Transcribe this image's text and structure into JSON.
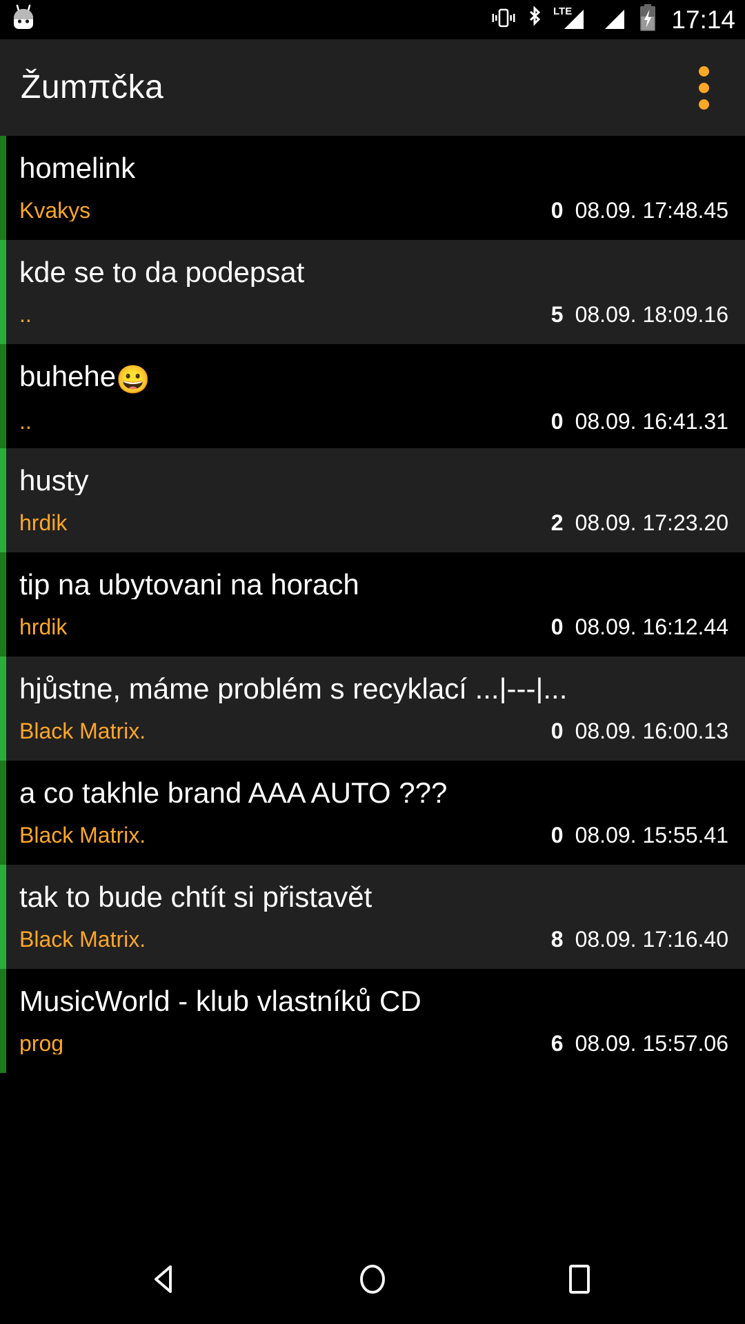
{
  "status_bar": {
    "notification_icon": "android-marshmallow-icon",
    "icons": [
      "vibrate-icon",
      "bluetooth-icon",
      "lte-signal-icon",
      "signal-icon",
      "battery-charging-icon"
    ],
    "clock": "17:14"
  },
  "toolbar": {
    "title": "Žumπčka",
    "overflow_label": "overflow-menu"
  },
  "colors": {
    "accent": "#FFA726",
    "stripe_dark": "#1B7A1B",
    "stripe_light": "#2BAD3A",
    "row_dark": "#000000",
    "row_light": "#212121",
    "text": "#FFFFFF"
  },
  "threads": [
    {
      "title": "homelink",
      "emoji": "",
      "author": "Kvakys",
      "count": "0",
      "date": "08.09. 17:48.45"
    },
    {
      "title": "kde se to da podepsat",
      "emoji": "",
      "author": "..",
      "count": "5",
      "date": "08.09. 18:09.16"
    },
    {
      "title": "buhehe",
      "emoji": "😀",
      "author": "..",
      "count": "0",
      "date": "08.09. 16:41.31"
    },
    {
      "title": "husty",
      "emoji": "",
      "author": "hrdik",
      "count": "2",
      "date": "08.09. 17:23.20"
    },
    {
      "title": "tip na ubytovani na horach",
      "emoji": "",
      "author": "hrdik",
      "count": "0",
      "date": "08.09. 16:12.44"
    },
    {
      "title": "hjůstne, máme problém s recyklací ...|---|...",
      "emoji": "",
      "author": "Black Matrix.",
      "count": "0",
      "date": "08.09. 16:00.13"
    },
    {
      "title": "a co takhle brand AAA AUTO ???",
      "emoji": "",
      "author": "Black Matrix.",
      "count": "0",
      "date": "08.09. 15:55.41"
    },
    {
      "title": "tak to bude chtít si přistavět",
      "emoji": "",
      "author": "Black Matrix.",
      "count": "8",
      "date": "08.09. 17:16.40"
    },
    {
      "title": "MusicWorld - klub vlastníků CD",
      "emoji": "",
      "author": "prog",
      "count": "6",
      "date": "08.09. 15:57.06"
    }
  ],
  "nav_bar": {
    "back_label": "back-button",
    "home_label": "home-button",
    "recents_label": "recents-button"
  }
}
